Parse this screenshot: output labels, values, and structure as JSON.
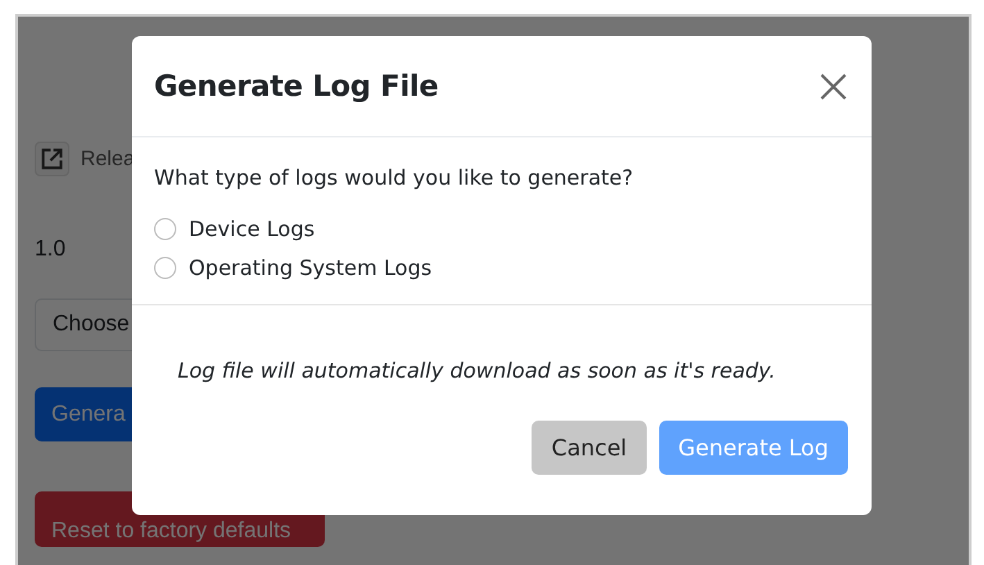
{
  "background": {
    "release_link": "Relea",
    "version": "1.0",
    "select": {
      "value": "Choose"
    },
    "generate_button": "Genera",
    "reset_button": "Reset to factory defaults"
  },
  "modal": {
    "title": "Generate Log File",
    "question": "What type of logs would you like to generate?",
    "options": [
      {
        "label": "Device Logs",
        "selected": false
      },
      {
        "label": "Operating System Logs",
        "selected": false
      }
    ],
    "note": "Log file will automatically download as soon as it's ready.",
    "buttons": [
      {
        "label": "Cancel",
        "kind": "secondary",
        "disabled": false
      },
      {
        "label": "Generate Log",
        "kind": "primary",
        "disabled": true
      }
    ]
  }
}
